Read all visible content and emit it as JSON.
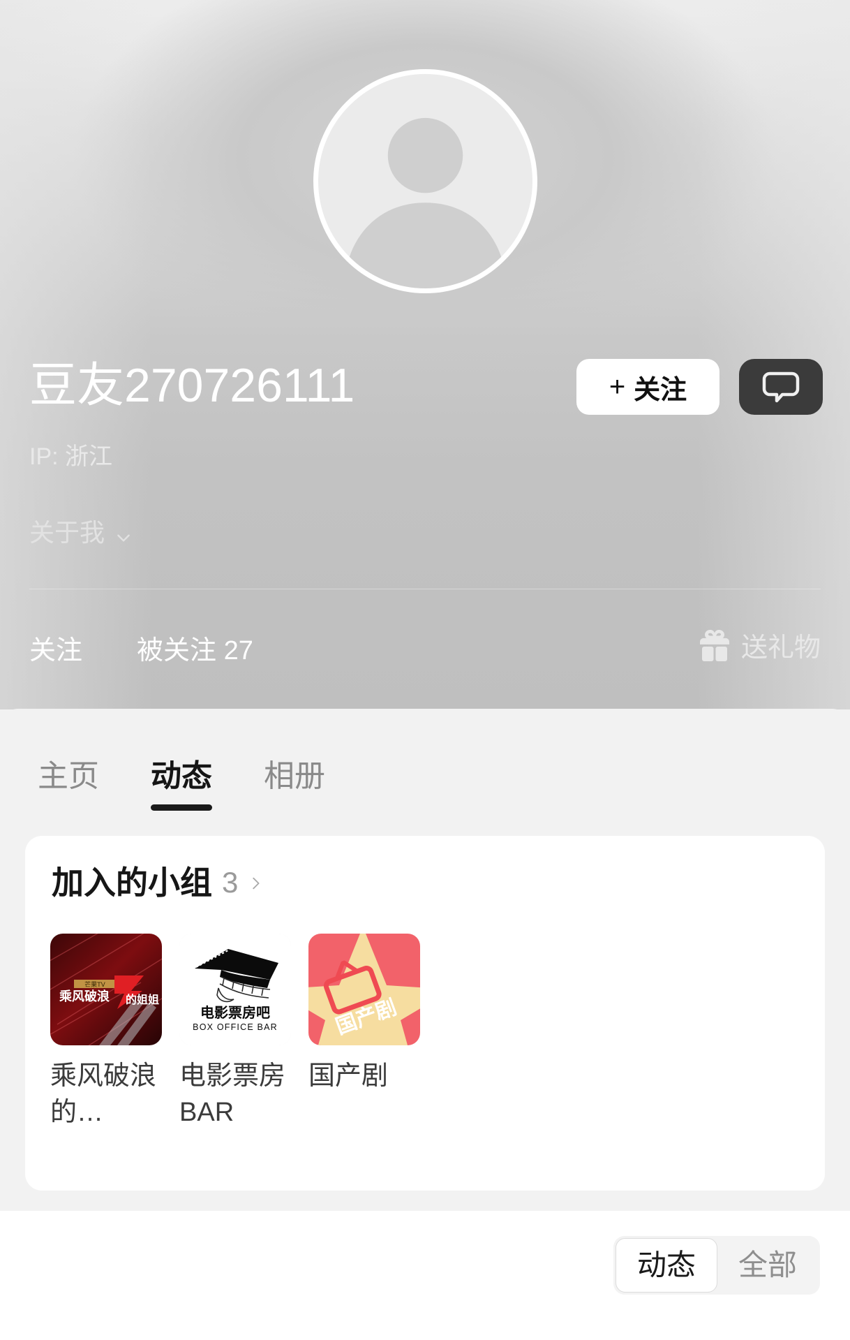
{
  "profile": {
    "display_name": "豆友270726111",
    "ip_label": "IP: 浙江",
    "about_label": "关于我",
    "avatar_icon": "default-person-avatar-icon",
    "follow_button": {
      "plus": "+",
      "label": "关注"
    },
    "message_button_icon": "chat-bubble-icon"
  },
  "stats": {
    "following_label": "关注",
    "followers_label": "被关注 27",
    "gift_label": "送礼物",
    "gift_icon": "gift-box-icon"
  },
  "tabs": [
    {
      "label": "主页",
      "active": false
    },
    {
      "label": "动态",
      "active": true
    },
    {
      "label": "相册",
      "active": false
    }
  ],
  "groups_card": {
    "title": "加入的小组",
    "count": "3",
    "chevron_icon": "chevron-right-icon",
    "items": [
      {
        "name": "乘风破浪的…",
        "thumb": "sisters-who-make-waves-7-poster"
      },
      {
        "name": "电影票房BAR",
        "thumb": "box-office-bar-film-strip",
        "thumb_text_cn": "电影票房吧",
        "thumb_text_en": "BOX OFFICE BAR"
      },
      {
        "name": "国产剧",
        "thumb": "domestic-drama-tv-star",
        "thumb_text_cn": "国产剧"
      }
    ]
  },
  "filter": {
    "options": [
      {
        "label": "动态",
        "active": true
      },
      {
        "label": "全部",
        "active": false
      }
    ]
  },
  "colors": {
    "header_gray": "#bfbfbf",
    "sheet_gray": "#f2f2f2",
    "card_white": "#ffffff",
    "accent_dark": "#1a1a1a",
    "muted_text": "#8a8a8a"
  }
}
